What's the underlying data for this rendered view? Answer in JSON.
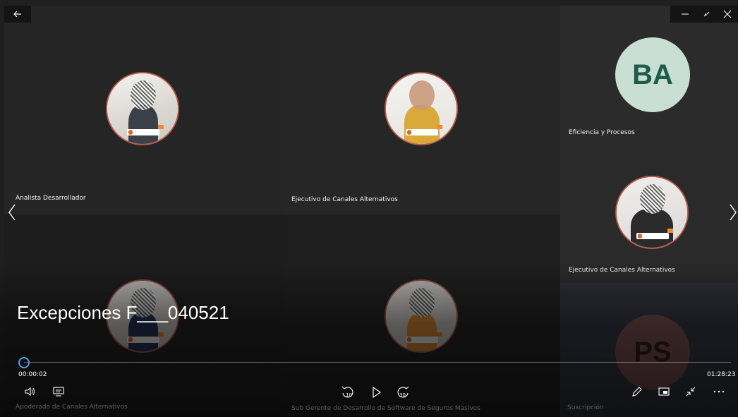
{
  "window": {
    "back_icon": "back-arrow-icon",
    "minimize_icon": "minimize-icon",
    "restore_icon": "exit-fullscreen-icon",
    "close_icon": "close-icon"
  },
  "participants": [
    {
      "label": "Analista Desarrollador"
    },
    {
      "label": "Ejecutivo de Canales Alternativos"
    },
    {
      "label": "Eficiencia y Procesos",
      "initials": "BA"
    },
    {
      "label": "Ejecutivo de Canales Alternativos"
    },
    {
      "label": "Apoderado de Canales Alternativos"
    },
    {
      "label": "Sub Gerente de Desarrollo de Software de Seguros Masivos"
    },
    {
      "label": "Suscripción",
      "initials": "PS"
    }
  ],
  "player": {
    "title": "Excepciones F___040521",
    "current_time": "00:00:02",
    "total_time": "01:28:23",
    "progress": 0.0004,
    "skip_back_label": "10",
    "skip_forward_label": "30"
  },
  "colors": {
    "progress_thumb": "#4aa3e8",
    "avatar_border": "#b65a4a",
    "ba_bg": "#c9dfd4"
  }
}
